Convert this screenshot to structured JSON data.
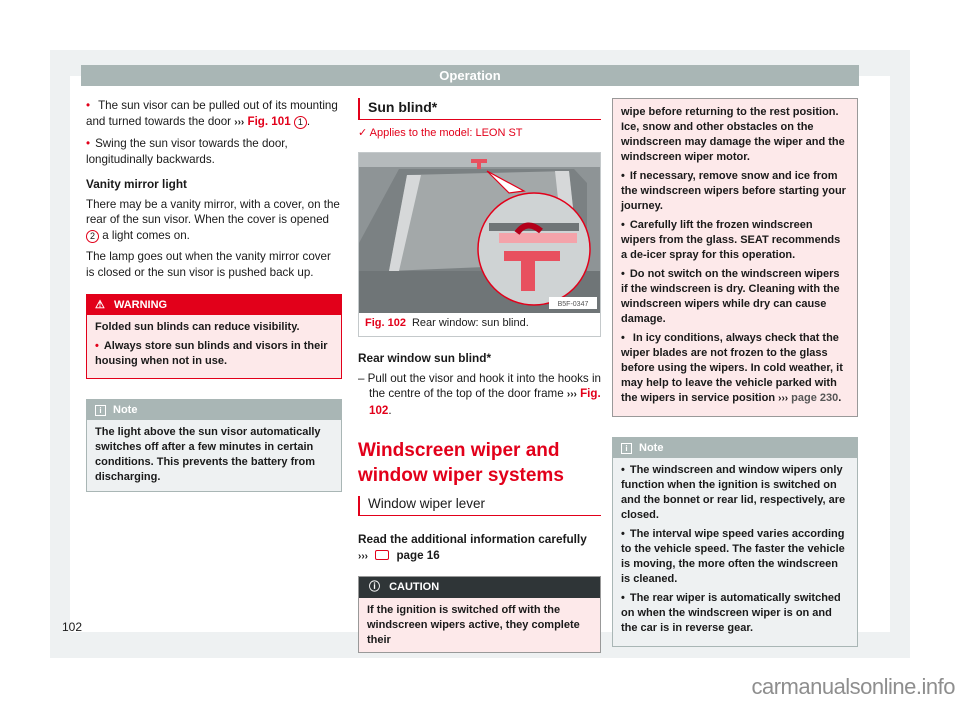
{
  "header": {
    "title": "Operation"
  },
  "col1": {
    "bullets": [
      {
        "text": "The sun visor can be pulled out of its mounting and turned towards the door ",
        "ref": "Fig. 101",
        "callout": "1"
      },
      {
        "text": "Swing the sun visor towards the door, longitudinally backwards."
      }
    ],
    "vanity_heading": "Vanity mirror light",
    "vanity_p1_before": "There may be a vanity mirror, with a cover, on the rear of the sun visor. When the cover is opened ",
    "vanity_p1_callout": "2",
    "vanity_p1_after": " a light comes on.",
    "vanity_p2": "The lamp goes out when the vanity mirror cover is closed or the sun visor is pushed back up.",
    "warning": {
      "label": "WARNING",
      "line1": "Folded sun blinds can reduce visibility.",
      "bullet": "Always store sun blinds and visors in their housing when not in use."
    },
    "note": {
      "label": "Note",
      "text": "The light above the sun visor automatically switches off after a few minutes in certain conditions. This prevents the battery from discharging."
    }
  },
  "col2": {
    "section_title": "Sun blind*",
    "applies": "Applies to the model: LEON ST",
    "figure": {
      "number": "Fig. 102",
      "caption": "Rear window: sun blind.",
      "code": "B5F-0347"
    },
    "rear_heading": "Rear window sun blind*",
    "rear_step": "Pull out the visor and hook it into the hooks in the centre of the top of the door frame ",
    "rear_step_ref": "Fig. 102",
    "big_title": "Windscreen wiper and window wiper systems",
    "sub_title": "Window wiper lever",
    "read_more": "Read the additional information carefully",
    "read_more_page": "page 16",
    "caution": {
      "label": "CAUTION",
      "text": "If the ignition is switched off with the windscreen wipers active, they complete their"
    }
  },
  "col3": {
    "caution_cont": "wipe before returning to the rest position. Ice, snow and other obstacles on the windscreen may damage the wiper and the windscreen wiper motor.",
    "caution_bullets": [
      "If necessary, remove snow and ice from the windscreen wipers before starting your journey.",
      "Carefully lift the frozen windscreen wipers from the glass. SEAT recommends a de-icer spray for this operation.",
      "Do not switch on the windscreen wipers if the windscreen is dry. Cleaning with the windscreen wipers while dry can cause damage."
    ],
    "caution_last": "In icy conditions, always check that the wiper blades are not frozen to the glass before using the wipers. In cold weather, it may help to leave the vehicle parked with the wipers in service position ",
    "caution_last_ref": "page 230",
    "note": {
      "label": "Note",
      "bullets": [
        "The windscreen and window wipers only function when the ignition is switched on and the bonnet or rear lid, respectively, are closed.",
        "The interval wipe speed varies according to the vehicle speed. The faster the vehicle is moving, the more often the windscreen is cleaned.",
        "The rear wiper is automatically switched on when the windscreen wiper is on and the car is in reverse gear."
      ]
    }
  },
  "footer": {
    "page_number": "102",
    "watermark": "carmanualsonline.info"
  },
  "glyphs": {
    "arrows": "›››",
    "check": "✓",
    "warning": "⚠",
    "caution": "ⓘ",
    "info": "i"
  }
}
